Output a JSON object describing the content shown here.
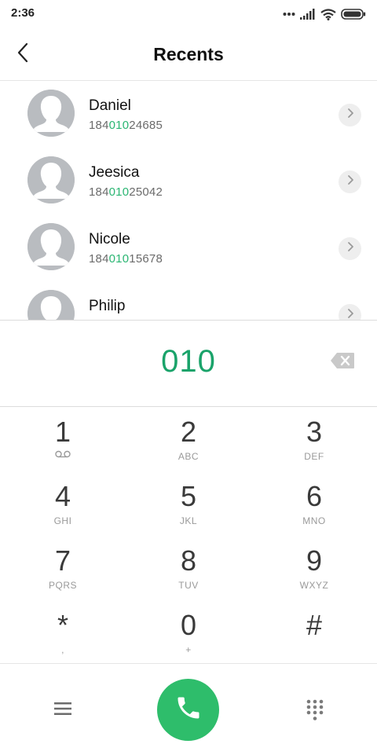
{
  "status_bar": {
    "time": "2:36",
    "icons": [
      "dots-icon",
      "signal-icon",
      "wifi-icon",
      "battery-icon"
    ]
  },
  "header": {
    "title": "Recents",
    "back_icon": "chevron-left-icon"
  },
  "contacts": [
    {
      "name": "Daniel",
      "number_prefix": "184",
      "number_match": "010",
      "number_suffix": "24685"
    },
    {
      "name": "Jeesica",
      "number_prefix": "184",
      "number_match": "010",
      "number_suffix": "25042"
    },
    {
      "name": "Nicole",
      "number_prefix": "184",
      "number_match": "010",
      "number_suffix": "15678"
    },
    {
      "name": "Philip",
      "number_prefix": "",
      "number_match": "",
      "number_suffix": ""
    }
  ],
  "dial": {
    "value": "010",
    "backspace_icon": "backspace-icon"
  },
  "keypad": [
    {
      "digit": "1",
      "letters": ""
    },
    {
      "digit": "2",
      "letters": "ABC"
    },
    {
      "digit": "3",
      "letters": "DEF"
    },
    {
      "digit": "4",
      "letters": "GHI"
    },
    {
      "digit": "5",
      "letters": "JKL"
    },
    {
      "digit": "6",
      "letters": "MNO"
    },
    {
      "digit": "7",
      "letters": "PQRS"
    },
    {
      "digit": "8",
      "letters": "TUV"
    },
    {
      "digit": "9",
      "letters": "WXYZ"
    },
    {
      "digit": "*",
      "letters": ","
    },
    {
      "digit": "0",
      "letters": "+"
    },
    {
      "digit": "#",
      "letters": ""
    }
  ],
  "bottom_bar": {
    "menu_icon": "hamburger-icon",
    "call_icon": "phone-icon",
    "grid_icon": "dialpad-grid-icon"
  },
  "colors": {
    "accent_green": "#2bb673",
    "call_button": "#2ebd6b",
    "avatar_gray": "#b9bcc0"
  }
}
